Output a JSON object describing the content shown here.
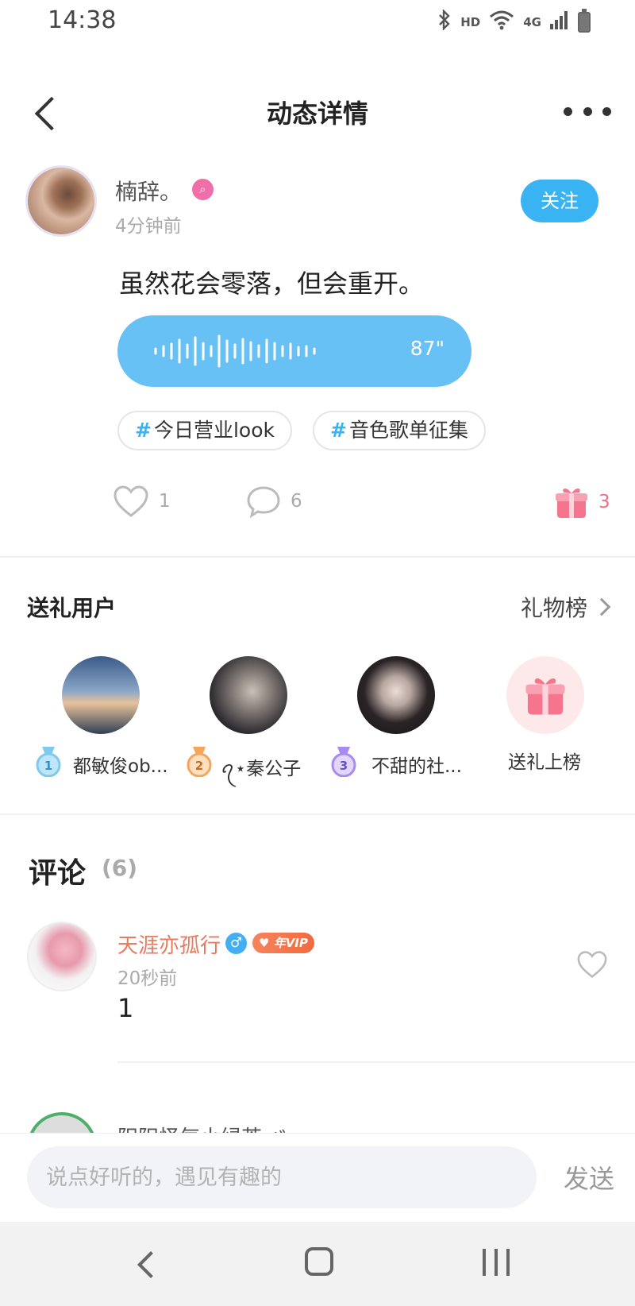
{
  "status_bar": {
    "time": "14:38",
    "indicators": [
      "bluetooth-icon",
      "HD",
      "wifi-icon",
      "4G",
      "signal-icon",
      "battery-icon"
    ],
    "hd_label": "HD",
    "network_label": "4G"
  },
  "header": {
    "title": "动态详情"
  },
  "post": {
    "author_name": "楠辞。",
    "time_ago": "4分钟前",
    "follow_label": "关注",
    "text": "虽然花会零落，但会重开。",
    "voice_duration": "87\"",
    "topics": [
      "今日营业look",
      "音色歌单征集"
    ],
    "likes": "1",
    "comments": "6",
    "gifts": "3"
  },
  "gift_section": {
    "title": "送礼用户",
    "rank_link": "礼物榜",
    "users": [
      {
        "rank": "1",
        "name": "都敏俊ob..."
      },
      {
        "rank": "2",
        "name": "ꪖ⋆秦公子"
      },
      {
        "rank": "3",
        "name": "不甜的社..."
      }
    ],
    "cta_label": "送礼上榜"
  },
  "comments_section": {
    "title": "评论",
    "count": "(6)",
    "items": [
      {
        "name": "天涯亦孤行",
        "vip": "年VIP",
        "time": "20秒前",
        "text": "1"
      }
    ],
    "partial_name": "阳阳怪气小绿茶.ゞ"
  },
  "input_bar": {
    "placeholder": "说点好听的，遇见有趣的",
    "send_label": "发送"
  },
  "colors": {
    "accent_blue": "#3ab3f3",
    "voice_bubble": "#68c1f5",
    "gift_pink": "#f06f8a",
    "commenter_orange": "#ea7a5e"
  }
}
